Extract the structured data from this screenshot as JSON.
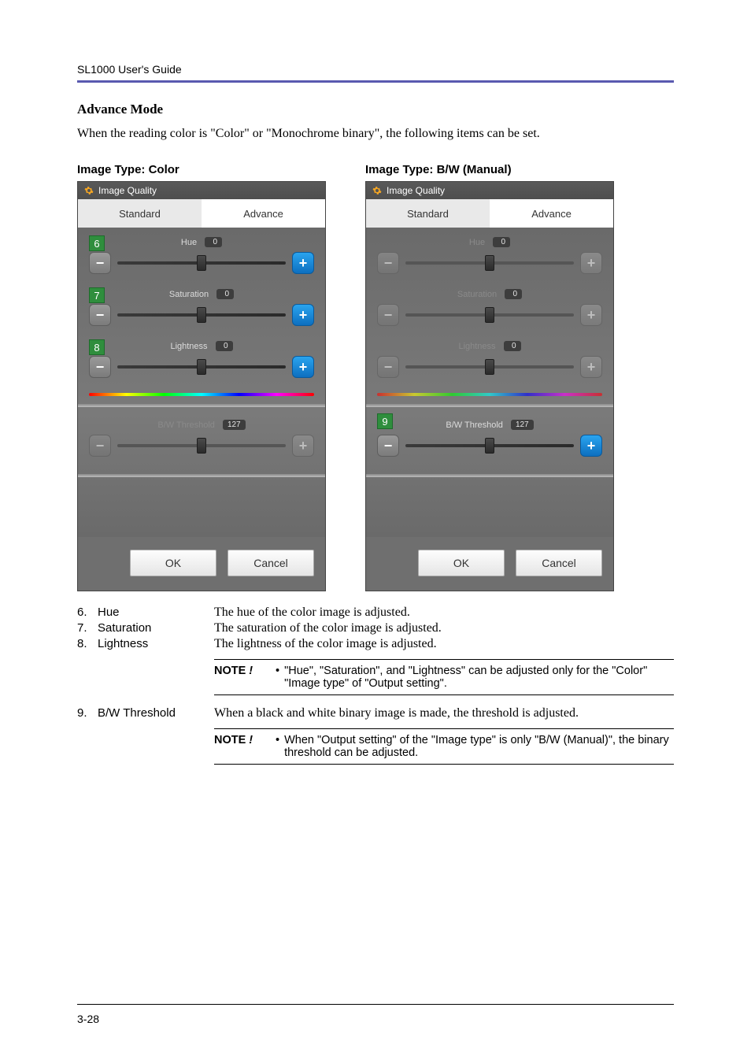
{
  "header": {
    "title": "SL1000 User's Guide"
  },
  "section": {
    "title": "Advance Mode"
  },
  "intro": "When the reading color is \"Color\" or \"Monochrome binary\", the following items can be set.",
  "columns": {
    "color": {
      "title": "Image Type: Color"
    },
    "bw": {
      "title": "Image Type: B/W (Manual)"
    }
  },
  "panel": {
    "title": "Image Quality",
    "tabs": {
      "standard": "Standard",
      "advance": "Advance"
    },
    "sliders": {
      "hue": {
        "label": "Hue",
        "value": "0"
      },
      "saturation": {
        "label": "Saturation",
        "value": "0"
      },
      "lightness": {
        "label": "Lightness",
        "value": "0"
      },
      "bw": {
        "label": "B/W Threshold",
        "value": "127"
      }
    },
    "buttons": {
      "ok": "OK",
      "cancel": "Cancel"
    }
  },
  "callouts": {
    "hue": "6",
    "sat": "7",
    "light": "8",
    "bw": "9"
  },
  "defs": {
    "hue": {
      "num": "6.",
      "term": "Hue",
      "desc": "The hue of the color image is adjusted."
    },
    "sat": {
      "num": "7.",
      "term": "Saturation",
      "desc": "The saturation of the color image is adjusted."
    },
    "light": {
      "num": "8.",
      "term": "Lightness",
      "desc": "The lightness of the color image is adjusted."
    },
    "bw": {
      "num": "9.",
      "term": "B/W Threshold",
      "desc": "When a black and white binary image is made, the threshold is adjusted."
    }
  },
  "notes": {
    "label": "NOTE",
    "bang": " !",
    "n1": "\"Hue\", \"Saturation\", and \"Lightness\" can be adjusted only for the \"Color\" \"Image type\" of \"Output setting\".",
    "n2": "When \"Output setting\" of the \"Image type\" is only \"B/W (Manual)\", the binary threshold can be adjusted."
  },
  "pagenum": "3-28"
}
